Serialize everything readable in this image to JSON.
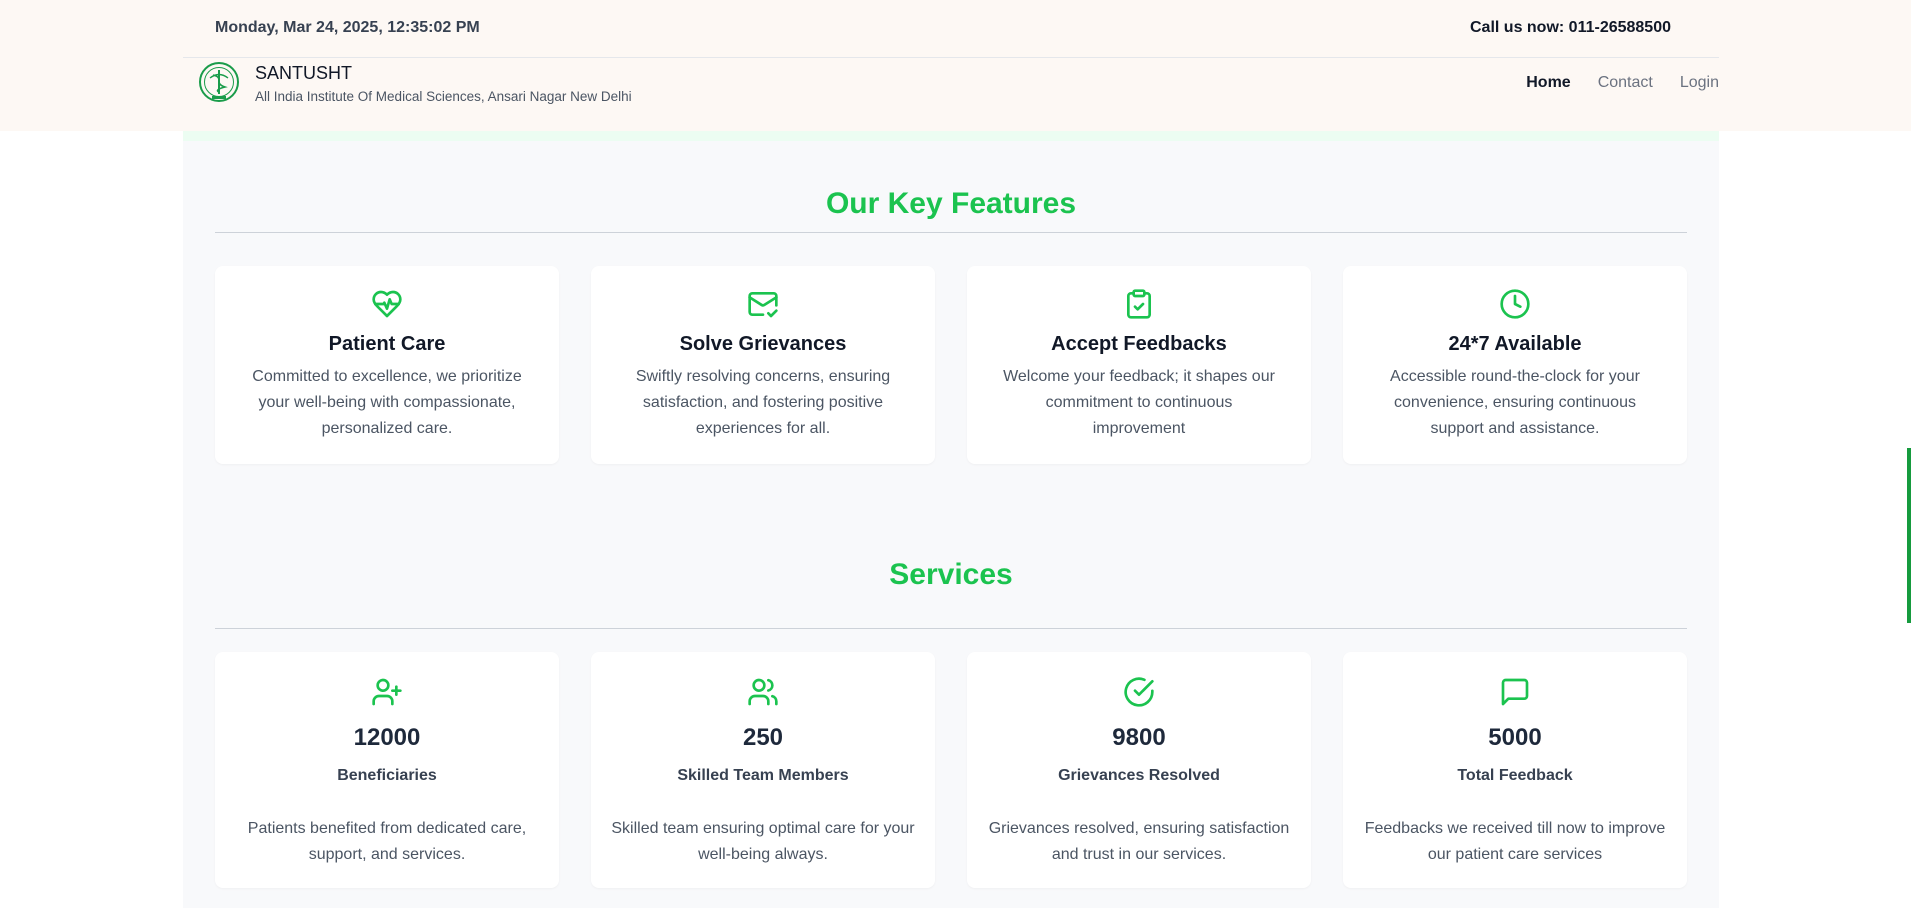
{
  "header": {
    "datetime": "Monday, Mar 24, 2025, 12:35:02 PM",
    "call_text": "Call us now: 011-26588500",
    "brand_name": "SANTUSHT",
    "brand_subtitle": "All India Institute Of Medical Sciences, Ansari Nagar New Delhi",
    "logo_icon": "aiims-emblem-icon",
    "nav": [
      {
        "label": "Home",
        "active": true
      },
      {
        "label": "Contact",
        "active": false
      },
      {
        "label": "Login",
        "active": false
      }
    ]
  },
  "colors": {
    "accent_green": "#1bc34f",
    "header_bg": "#fdf8f4",
    "section_bg": "#f8f9fb"
  },
  "features": {
    "title": "Our Key Features",
    "items": [
      {
        "icon": "heart-pulse-icon",
        "title": "Patient Care",
        "description": "Committed to excellence, we prioritize your well-being with compassionate, personalized care."
      },
      {
        "icon": "mail-check-icon",
        "title": "Solve Grievances",
        "description": "Swiftly resolving concerns, ensuring satisfaction, and fostering positive experiences for all."
      },
      {
        "icon": "clipboard-check-icon",
        "title": "Accept Feedbacks",
        "description": "Welcome your feedback; it shapes our commitment to continuous improvement"
      },
      {
        "icon": "clock-icon",
        "title": "24*7 Available",
        "description": "Accessible round-the-clock for your convenience, ensuring continuous support and assistance."
      }
    ]
  },
  "services": {
    "title": "Services",
    "items": [
      {
        "icon": "user-plus-icon",
        "count": "12000",
        "label": "Beneficiaries",
        "description": "Patients benefited from dedicated care, support, and services."
      },
      {
        "icon": "users-icon",
        "count": "250",
        "label": "Skilled Team Members",
        "description": "Skilled team ensuring optimal care for your well-being always."
      },
      {
        "icon": "circle-check-icon",
        "count": "9800",
        "label": "Grievances Resolved",
        "description": "Grievances resolved, ensuring satisfaction and trust in our services."
      },
      {
        "icon": "message-square-icon",
        "count": "5000",
        "label": "Total Feedback",
        "description": "Feedbacks we received till now to improve our patient care services"
      }
    ]
  }
}
